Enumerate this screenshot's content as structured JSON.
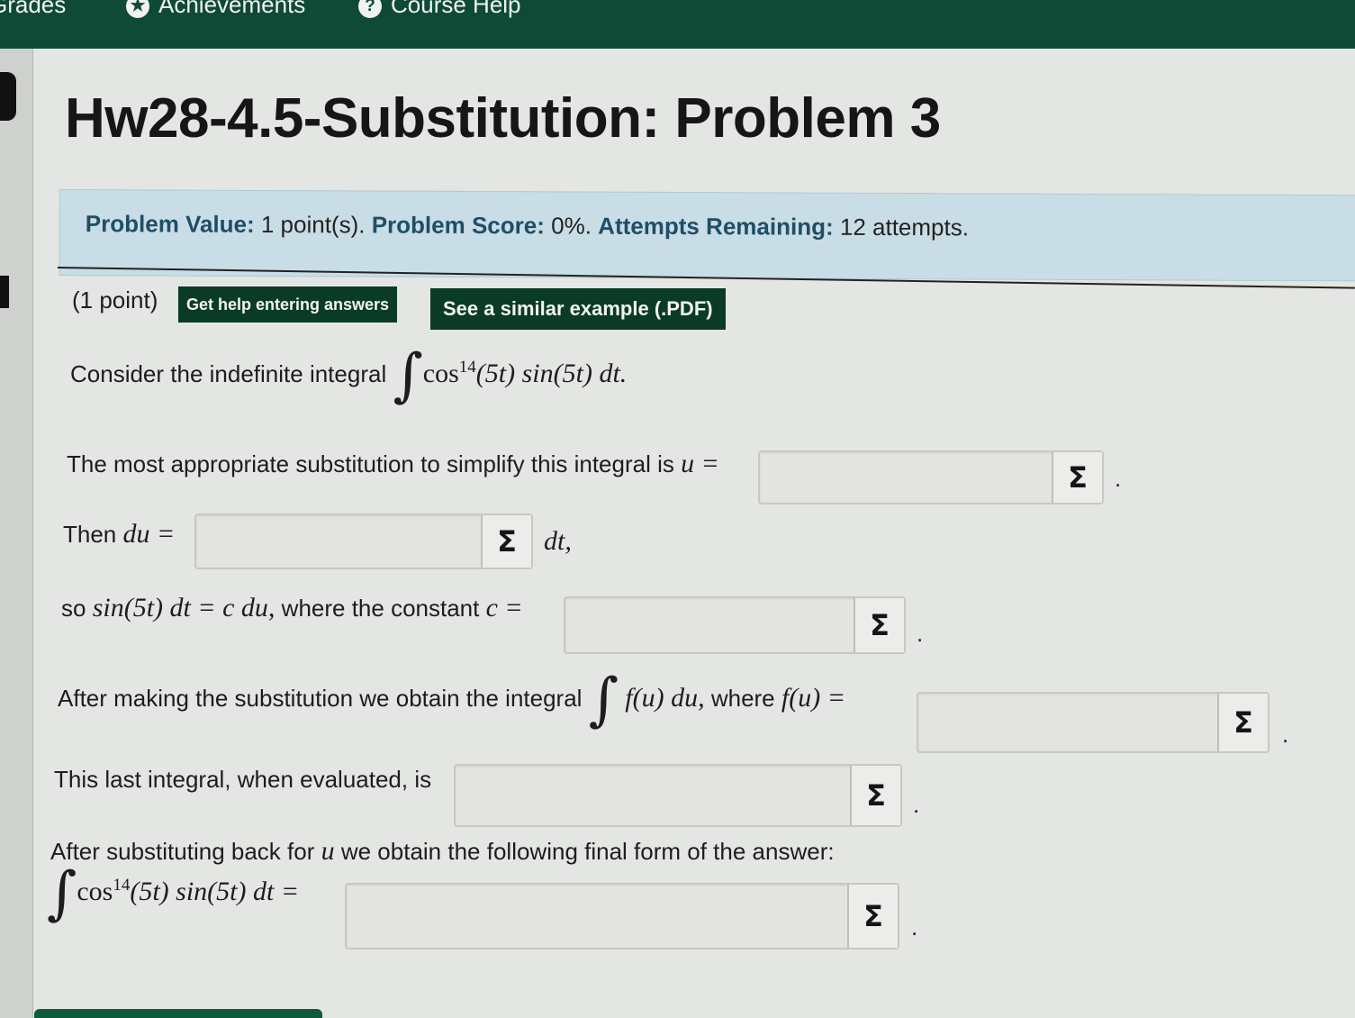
{
  "nav": {
    "grades": "Grades",
    "achievements": "Achievements",
    "course_help": "Course Help"
  },
  "title": "Hw28-4.5-Substitution: Problem 3",
  "info": {
    "value_label": "Problem Value:",
    "value": "1 point(s).",
    "score_label": "Problem Score:",
    "score": "0%.",
    "attempts_label": "Attempts Remaining:",
    "attempts": "12 attempts."
  },
  "problem": {
    "points": "(1 point)",
    "help_button": "Get help entering answers",
    "example_button": "See a similar example (.PDF)",
    "consider_text": "Consider the indefinite integral",
    "integrand_head": "cos",
    "power": "14",
    "integrand_tail": "(5t) sin(5t) dt.",
    "sub_text": "The most appropriate substitution to simplify this integral is",
    "u_eq": "u =",
    "then_text": "Then",
    "du_eq": "du =",
    "dt_comma": "dt,",
    "so_text": "so",
    "so_math": "sin(5t) dt = c du,",
    "constant_text": "where the constant",
    "c_eq": "c =",
    "after_text": "After making the substitution we obtain the integral",
    "fu_du": "f(u) du,",
    "where_text": "where",
    "fu_eq": "f(u) =",
    "last_text": "This last integral, when evaluated, is",
    "back_text_1": "After substituting back for",
    "back_u": "u",
    "back_text_2": "we obtain the following final form of the answer:",
    "final_tail": "(5t) sin(5t) dt =",
    "sigma": "Σ",
    "period": "."
  }
}
